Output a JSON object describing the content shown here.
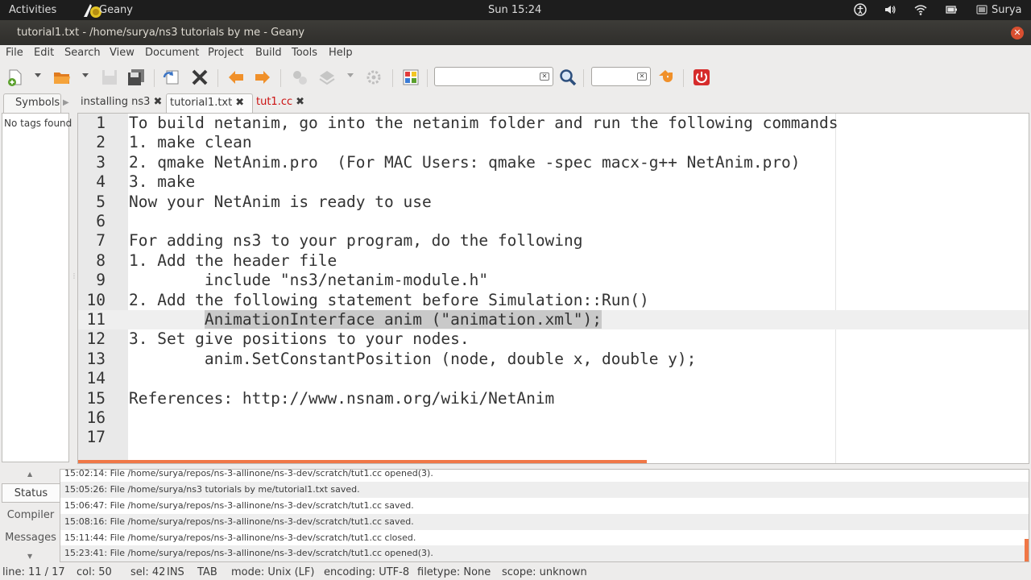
{
  "top_panel": {
    "activities": "Activities",
    "app_name": "Geany",
    "clock": "Sun 15:24",
    "user": "Surya"
  },
  "window": {
    "title": "tutorial1.txt - /home/surya/ns3 tutorials by me - Geany",
    "close_glyph": "✕"
  },
  "menu": [
    "File",
    "Edit",
    "Search",
    "View",
    "Document",
    "Project",
    "Build",
    "Tools",
    "Help"
  ],
  "toolbar": {
    "search_value": "",
    "goto_value": ""
  },
  "sidebar": {
    "tab_label": "Symbols",
    "empty_text": "No tags found"
  },
  "tabs": [
    {
      "label": "installing ns3",
      "state": "normal"
    },
    {
      "label": "tutorial1.txt",
      "state": "active"
    },
    {
      "label": "tut1.cc",
      "state": "modified"
    }
  ],
  "editor": {
    "lines": [
      {
        "num": "1",
        "text": "To build netanim, go into the netanim folder and run the following commands"
      },
      {
        "num": "2",
        "text": "1. make clean"
      },
      {
        "num": "3",
        "text": "2. qmake NetAnim.pro  (For MAC Users: qmake -spec macx-g++ NetAnim.pro)"
      },
      {
        "num": "4",
        "text": "3. make"
      },
      {
        "num": "5",
        "text": "Now your NetAnim is ready to use"
      },
      {
        "num": "6",
        "text": ""
      },
      {
        "num": "7",
        "text": "For adding ns3 to your program, do the following"
      },
      {
        "num": "8",
        "text": "1. Add the header file"
      },
      {
        "num": "9",
        "text": "        include \"ns3/netanim-module.h\""
      },
      {
        "num": "10",
        "text": "2. Add the following statement before Simulation::Run()"
      },
      {
        "num": "11",
        "text": "AnimationInterface anim (\"animation.xml\");"
      },
      {
        "num": "12",
        "text": "3. Set give positions to your nodes."
      },
      {
        "num": "13",
        "text": "        anim.SetConstantPosition (node, double x, double y);"
      },
      {
        "num": "14",
        "text": ""
      },
      {
        "num": "15",
        "text": "References: http://www.nsnam.org/wiki/NetAnim"
      },
      {
        "num": "16",
        "text": ""
      },
      {
        "num": "17",
        "text": ""
      }
    ],
    "current_line_indent": "        "
  },
  "bottom_tabs": [
    "Status",
    "Compiler",
    "Messages"
  ],
  "messages": [
    "15:02:14: File /home/surya/repos/ns-3-allinone/ns-3-dev/scratch/tut1.cc opened(3).",
    "15:05:26: File /home/surya/ns3 tutorials by me/tutorial1.txt saved.",
    "15:06:47: File /home/surya/repos/ns-3-allinone/ns-3-dev/scratch/tut1.cc saved.",
    "15:08:16: File /home/surya/repos/ns-3-allinone/ns-3-dev/scratch/tut1.cc saved.",
    "15:11:44: File /home/surya/repos/ns-3-allinone/ns-3-dev/scratch/tut1.cc closed.",
    "15:23:41: File /home/surya/repos/ns-3-allinone/ns-3-dev/scratch/tut1.cc opened(3)."
  ],
  "status": {
    "line": "line: 11 / 17",
    "col": "col: 50",
    "sel": "sel: 42",
    "mode_ins": "INS",
    "tab": "TAB",
    "mode": "mode: Unix (LF)",
    "encoding": "encoding: UTF-8",
    "filetype": "filetype: None",
    "scope": "scope: unknown"
  },
  "colors": {
    "accent_orange": "#f07746",
    "modified_tab": "#cc1111",
    "panel_dark": "#1d1d1d"
  }
}
